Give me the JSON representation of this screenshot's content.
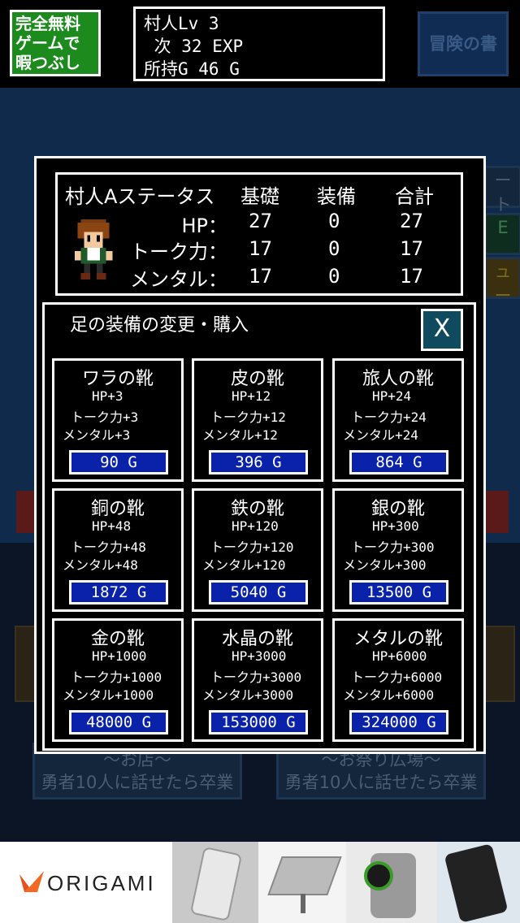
{
  "logo": {
    "lines": [
      "完全無料",
      "ゲームで",
      "暇つぶし"
    ]
  },
  "status": {
    "level": "村人Lv 3",
    "next_exp": " 次 32 EXP",
    "gold": "所持G 46 G"
  },
  "book_button": "冒険の書",
  "background": {
    "side_buttons": [
      "ート",
      "E",
      "ュー"
    ],
    "bottom_left": {
      "title": "～お店～",
      "sub": "勇者10人に話せたら卒業"
    },
    "bottom_right": {
      "title": "～お祭り広場～",
      "sub": "勇者10人に話せたら卒業"
    }
  },
  "stats": {
    "title": "村人Aステータス",
    "headers": [
      "基礎",
      "装備",
      "合計"
    ],
    "rows": [
      {
        "label": "HP：",
        "base": "27",
        "equip": "0",
        "total": "27"
      },
      {
        "label": "トーク力：",
        "base": "17",
        "equip": "0",
        "total": "17"
      },
      {
        "label": "メンタル：",
        "base": "17",
        "equip": "0",
        "total": "17"
      }
    ]
  },
  "shop": {
    "title": "足の装備の変更・購入",
    "close": "X",
    "items": [
      {
        "name": "ワラの靴",
        "hp": "HP+3",
        "talk": "トーク力+3",
        "mental": "メンタル+3",
        "price": "90 G"
      },
      {
        "name": "皮の靴",
        "hp": "HP+12",
        "talk": "トーク力+12",
        "mental": "メンタル+12",
        "price": "396 G"
      },
      {
        "name": "旅人の靴",
        "hp": "HP+24",
        "talk": "トーク力+24",
        "mental": "メンタル+24",
        "price": "864 G"
      },
      {
        "name": "銅の靴",
        "hp": "HP+48",
        "talk": "トーク力+48",
        "mental": "メンタル+48",
        "price": "1872 G"
      },
      {
        "name": "鉄の靴",
        "hp": "HP+120",
        "talk": "トーク力+120",
        "mental": "メンタル+120",
        "price": "5040 G"
      },
      {
        "name": "銀の靴",
        "hp": "HP+300",
        "talk": "トーク力+300",
        "mental": "メンタル+300",
        "price": "13500 G"
      },
      {
        "name": "金の靴",
        "hp": "HP+1000",
        "talk": "トーク力+1000",
        "mental": "メンタル+1000",
        "price": "48000 G"
      },
      {
        "name": "水晶の靴",
        "hp": "HP+3000",
        "talk": "トーク力+3000",
        "mental": "メンタル+3000",
        "price": "153000 G"
      },
      {
        "name": "メタルの靴",
        "hp": "HP+6000",
        "talk": "トーク力+6000",
        "mental": "メンタル+6000",
        "price": "324000 G"
      }
    ]
  },
  "ad": {
    "brand": "ORIGAMI"
  },
  "colors": {
    "price_button": "#0a22aa",
    "logo_bg": "#1d8a1d",
    "close_bg": "#0f4a5e"
  }
}
